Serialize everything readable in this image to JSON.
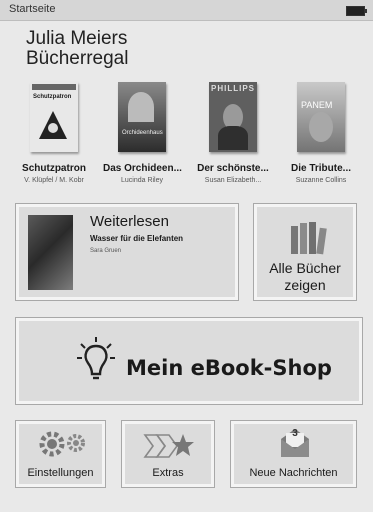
{
  "status": {
    "title": "Startseite"
  },
  "library": {
    "owner_line1": "Julia Meiers",
    "owner_line2": "Bücherregal"
  },
  "books": [
    {
      "title": "Schutzpatron",
      "author": "V. Klüpfel / M. Kobr",
      "cover_top": "Schutzpatron"
    },
    {
      "title": "Das Orchideen...",
      "author": "Lucinda Riley",
      "cover_top": "Orchideenhaus"
    },
    {
      "title": "Der schönste...",
      "author": "Susan Elizabeth...",
      "cover_top": "PHILLIPS"
    },
    {
      "title": "Die Tribute...",
      "author": "Suzanne Collins",
      "cover_top": "PANEM"
    }
  ],
  "continue_reading": {
    "heading": "Weiterlesen",
    "book_title": "Wasser für die Elefanten",
    "author": "Sara Gruen"
  },
  "all_books": {
    "line1": "Alle Bücher",
    "line2": "zeigen"
  },
  "shop": {
    "label": "Mein eBook-Shop"
  },
  "bottom": {
    "settings": "Einstellungen",
    "extras": "Extras",
    "messages": "Neue Nachrichten",
    "message_count": "3"
  }
}
